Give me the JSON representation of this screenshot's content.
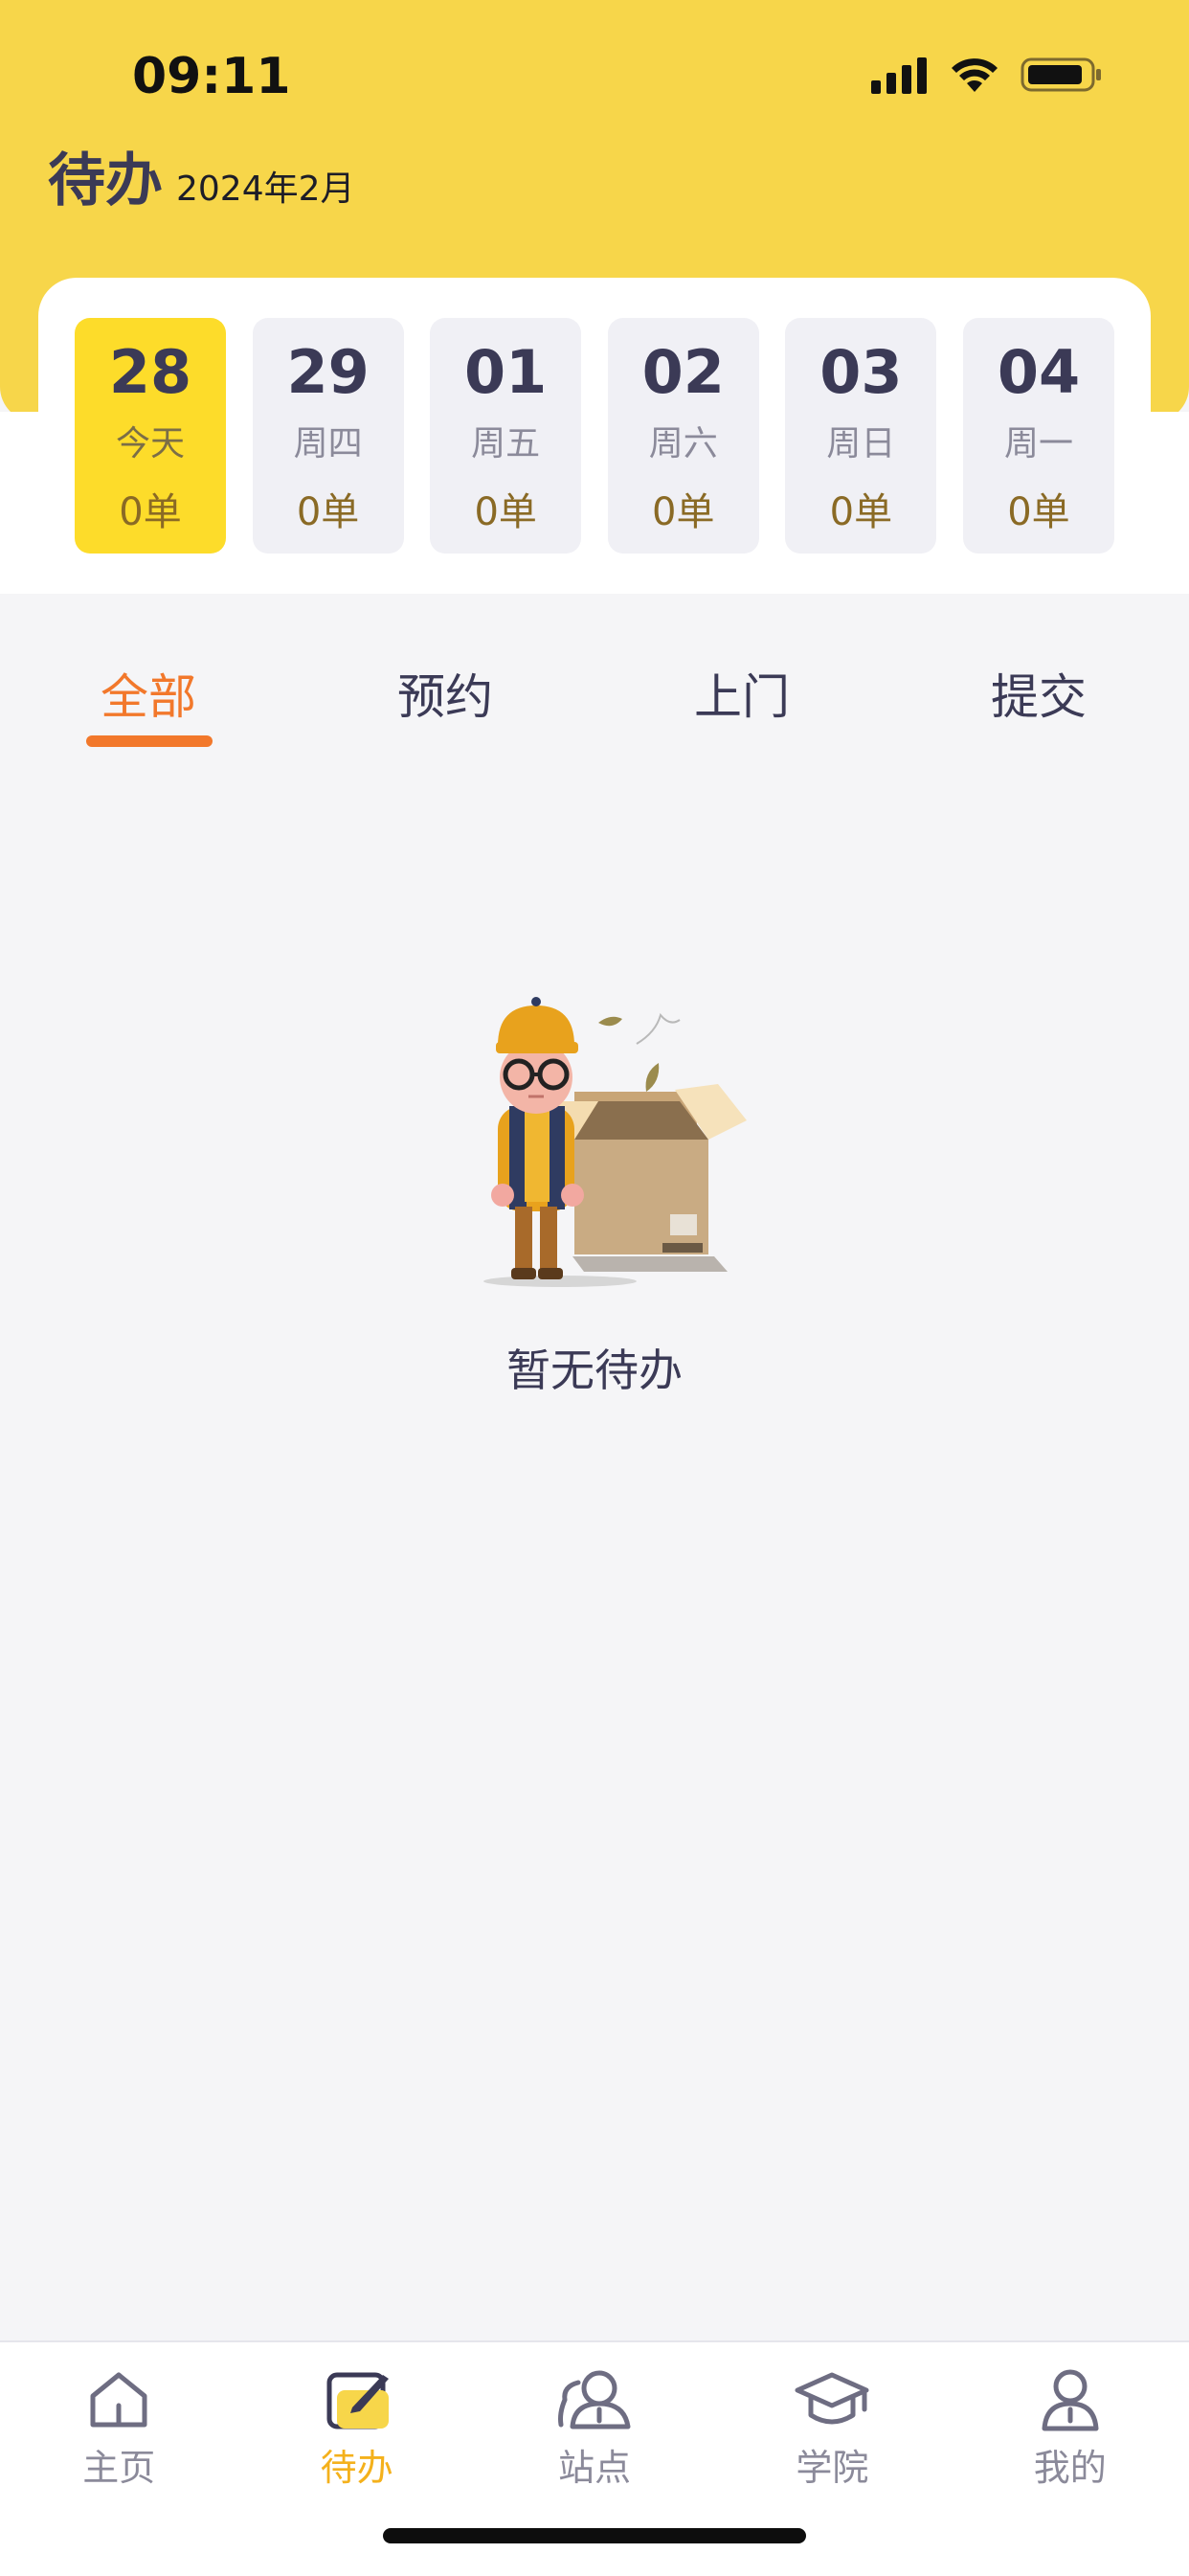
{
  "status_bar": {
    "time": "09:11"
  },
  "header": {
    "title": "待办",
    "month": "2024年2月"
  },
  "dates": [
    {
      "day": "28",
      "week": "今天",
      "count": "0单",
      "active": true
    },
    {
      "day": "29",
      "week": "周四",
      "count": "0单",
      "active": false
    },
    {
      "day": "01",
      "week": "周五",
      "count": "0单",
      "active": false
    },
    {
      "day": "02",
      "week": "周六",
      "count": "0单",
      "active": false
    },
    {
      "day": "03",
      "week": "周日",
      "count": "0单",
      "active": false
    },
    {
      "day": "04",
      "week": "周一",
      "count": "0单",
      "active": false
    }
  ],
  "tabs": [
    {
      "label": "全部",
      "active": true
    },
    {
      "label": "预约",
      "active": false
    },
    {
      "label": "上门",
      "active": false
    },
    {
      "label": "提交",
      "active": false
    }
  ],
  "empty_state": {
    "text": "暂无待办"
  },
  "bottom_nav": [
    {
      "label": "主页",
      "icon": "home-icon",
      "active": false
    },
    {
      "label": "待办",
      "icon": "todo-icon",
      "active": true
    },
    {
      "label": "站点",
      "icon": "station-icon",
      "active": false
    },
    {
      "label": "学院",
      "icon": "academy-icon",
      "active": false
    },
    {
      "label": "我的",
      "icon": "profile-icon",
      "active": false
    }
  ],
  "colors": {
    "header_yellow": "#f7d64a",
    "active_date": "#fddc2a",
    "accent_orange": "#f2782b",
    "nav_active": "#f4b11c"
  }
}
